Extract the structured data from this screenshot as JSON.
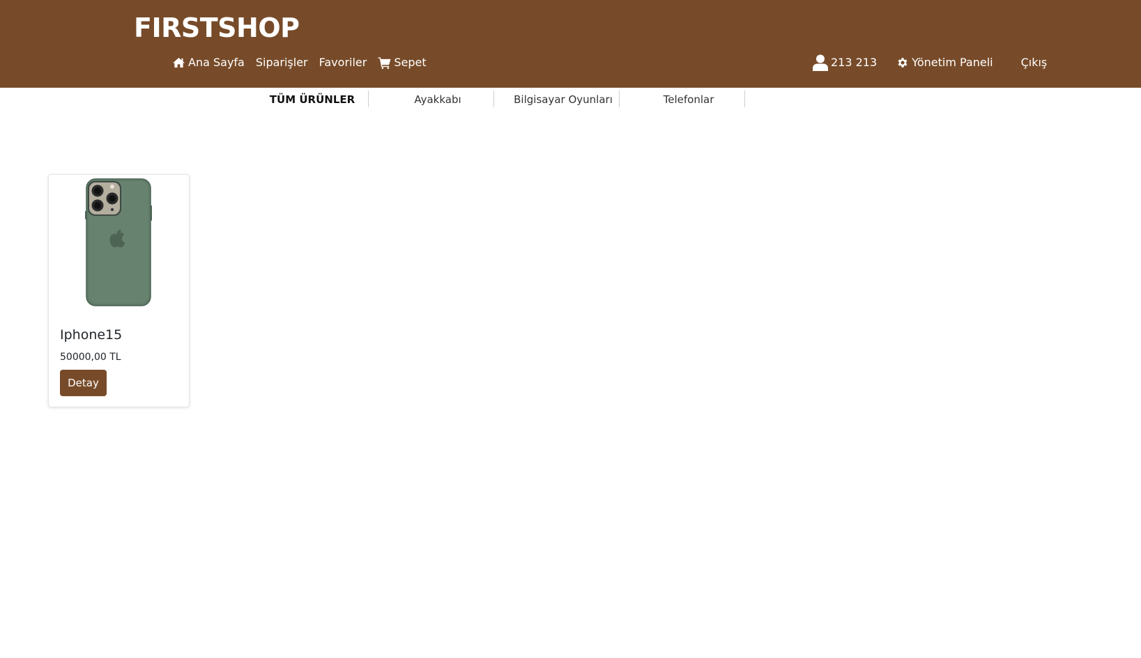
{
  "header": {
    "brand": "FIRSTSHOP",
    "background_color": "#774b29",
    "nav_left": [
      {
        "label": "Ana Sayfa",
        "icon": "home-icon"
      },
      {
        "label": "Siparişler"
      },
      {
        "label": "Favoriler"
      },
      {
        "label": "Sepet",
        "icon": "cart-icon"
      }
    ],
    "nav_right": [
      {
        "label": "213 213",
        "icon": "user-icon"
      },
      {
        "label": "Yönetim Paneli",
        "icon": "gear-icon"
      },
      {
        "label": "Çıkış"
      }
    ]
  },
  "categories": [
    {
      "label": "TÜM ÜRÜNLER",
      "active": true
    },
    {
      "label": "Ayakkabı",
      "active": false
    },
    {
      "label": "Bilgisayar Oyunları",
      "active": false
    },
    {
      "label": "Telefonlar",
      "active": false
    }
  ],
  "products": [
    {
      "name": "Iphone15",
      "price": "50000,00 TL",
      "button_label": "Detay",
      "image_icon": "phone-case-image"
    }
  ],
  "colors": {
    "accent": "#774b29",
    "phone_case": "#5f7a67"
  }
}
